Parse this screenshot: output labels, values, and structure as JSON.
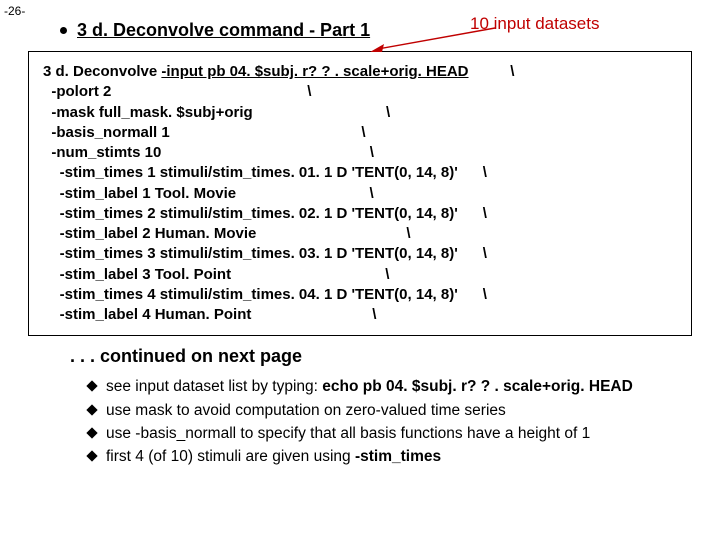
{
  "pageNumber": "-26-",
  "heading": "3 d. Deconvolve command - Part 1",
  "callout": "10 input datasets",
  "code": {
    "l0a": "3 d. Deconvolve ",
    "l0b": "-input pb 04. $subj. r? ? . scale+orig. HEAD",
    "l0c": "          \\",
    "l1": "  -polort 2                                               \\",
    "l2": "  -mask full_mask. $subj+orig                                \\",
    "l3": "  -basis_normall 1                                              \\",
    "l4": "  -num_stimts 10                                                  \\",
    "l5": "    -stim_times 1 stimuli/stim_times. 01. 1 D 'TENT(0, 14, 8)'      \\",
    "l6": "    -stim_label 1 Tool. Movie                                \\",
    "l7": "    -stim_times 2 stimuli/stim_times. 02. 1 D 'TENT(0, 14, 8)'      \\",
    "l8": "    -stim_label 2 Human. Movie                                    \\",
    "l9": "    -stim_times 3 stimuli/stim_times. 03. 1 D 'TENT(0, 14, 8)'      \\",
    "l10": "    -stim_label 3 Tool. Point                                     \\",
    "l11": "    -stim_times 4 stimuli/stim_times. 04. 1 D 'TENT(0, 14, 8)'      \\",
    "l12": "    -stim_label 4 Human. Point                             \\"
  },
  "continued": ". . . continued on next page",
  "notes": {
    "n0a": "see input dataset list by typing:   ",
    "n0b": "echo pb 04. $subj. r? ? . scale+orig. HEAD",
    "n1": "use mask to avoid computation on zero-valued time series",
    "n2": "use -basis_normall to specify that all basis functions have a height of 1",
    "n3a": "first 4 (of 10) stimuli are given using ",
    "n3b": "-stim_times"
  }
}
